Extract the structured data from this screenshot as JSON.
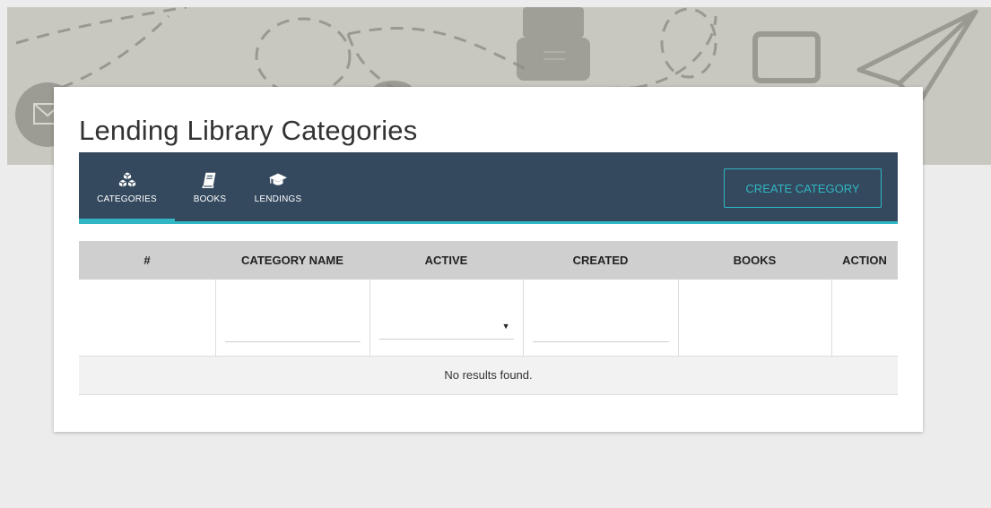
{
  "page": {
    "title": "Lending Library Categories"
  },
  "nav": {
    "tabs": [
      {
        "label": "CATEGORIES",
        "icon": "cubes-icon",
        "active": true
      },
      {
        "label": "BOOKS",
        "icon": "book-icon",
        "active": false
      },
      {
        "label": "LENDINGS",
        "icon": "graduation-cap-icon",
        "active": false
      }
    ],
    "create_button_label": "CREATE CATEGORY"
  },
  "table": {
    "columns": [
      "#",
      "CATEGORY NAME",
      "ACTIVE",
      "CREATED",
      "BOOKS",
      "ACTION"
    ],
    "filters": {
      "category_name": {
        "value": "",
        "placeholder": ""
      },
      "active": {
        "selected": ""
      },
      "created": {
        "value": "",
        "placeholder": ""
      }
    },
    "empty_message": "No results found."
  },
  "colors": {
    "navbar": "#34495e",
    "accent": "#30b6c4",
    "table_header": "#cfcfcf",
    "page_background": "#ececec"
  }
}
